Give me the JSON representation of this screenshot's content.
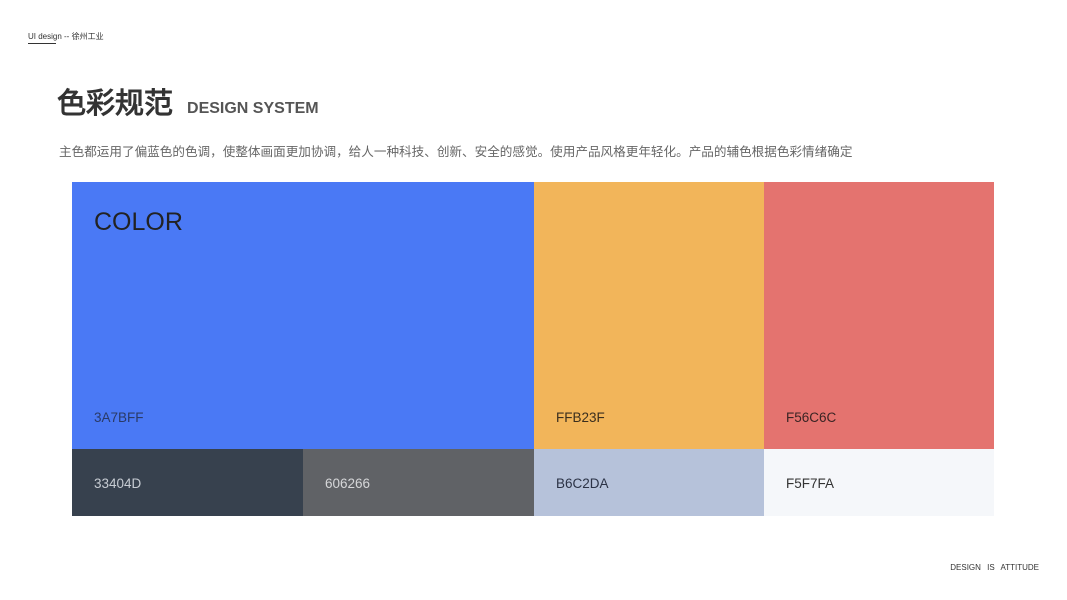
{
  "header": {
    "brand_tag": "UI design -- 徐州工业"
  },
  "title": {
    "cn": "色彩规范",
    "en": "DESIGN SYSTEM"
  },
  "description": "主色都运用了偏蓝色的色调，使整体画面更加协调，给人一种科技、创新、安全的感觉。使用产品风格更年轻化。产品的辅色根据色彩情绪确定",
  "palette": {
    "label": "COLOR",
    "primary": {
      "code": "3A7BFF",
      "color": "#4A79F5"
    },
    "secondary": [
      {
        "code": "FFB23F",
        "color": "#F2B55A"
      },
      {
        "code": "F56C6C",
        "color": "#E4736F"
      }
    ],
    "neutrals": [
      {
        "code": "33404D",
        "color": "#37414E"
      },
      {
        "code": "606266",
        "color": "#606266"
      },
      {
        "code": "B6C2DA",
        "color": "#B6C2DA"
      },
      {
        "code": "F5F7FA",
        "color": "#F5F7FA"
      }
    ]
  },
  "footer": {
    "tagline": "DESIGN IS ATTITUDE"
  }
}
